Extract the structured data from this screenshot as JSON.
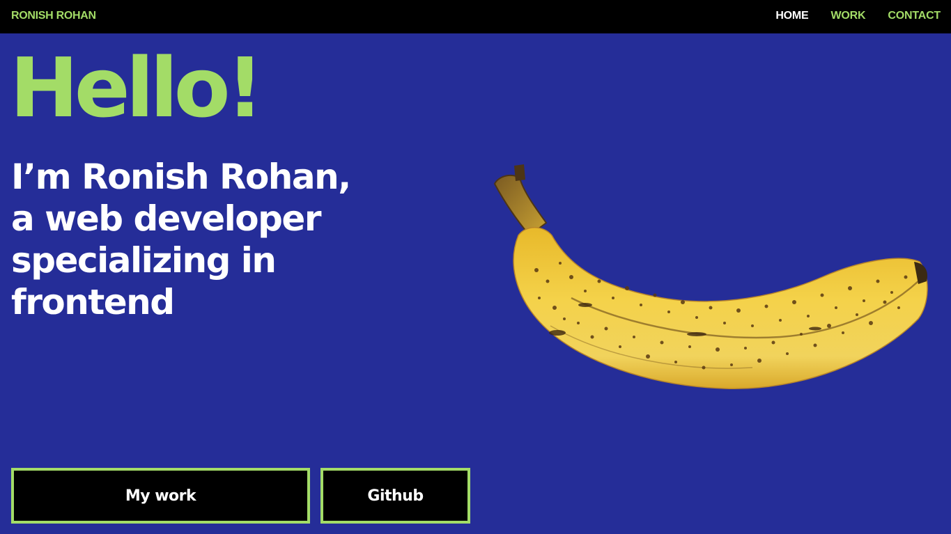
{
  "nav": {
    "brand": "RONISH ROHAN",
    "links": [
      {
        "label": "HOME",
        "active": true
      },
      {
        "label": "WORK",
        "active": false
      },
      {
        "label": "CONTACT",
        "active": false
      }
    ]
  },
  "hero": {
    "greeting": "Hello!",
    "intro_lines": [
      "I’m Ronish Rohan,",
      "a web developer",
      "specializing in",
      "frontend"
    ],
    "image": "banana-photo",
    "buttons": {
      "work_label": "My work",
      "github_label": "Github"
    }
  },
  "colors": {
    "background": "#252d98",
    "accent": "#a3dc67",
    "navbar": "#000000",
    "text": "#ffffff"
  }
}
